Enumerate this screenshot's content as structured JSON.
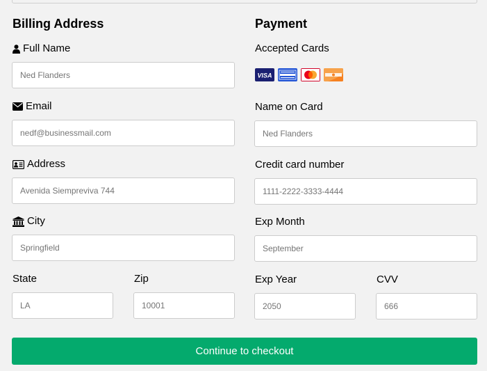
{
  "billing": {
    "heading": "Billing Address",
    "full_name_label": "Full Name",
    "full_name_placeholder": "Ned Flanders",
    "email_label": "Email",
    "email_placeholder": "nedf@businessmail.com",
    "address_label": "Address",
    "address_placeholder": "Avenida Siempreviva 744",
    "city_label": "City",
    "city_placeholder": "Springfield",
    "state_label": "State",
    "state_placeholder": "LA",
    "zip_label": "Zip",
    "zip_placeholder": "10001"
  },
  "payment": {
    "heading": "Payment",
    "accepted_cards_label": "Accepted Cards",
    "cards": [
      "visa-card-icon",
      "amex-card-icon",
      "mastercard-card-icon",
      "discover-card-icon"
    ],
    "name_on_card_label": "Name on Card",
    "name_on_card_placeholder": "Ned Flanders",
    "card_number_label": "Credit card number",
    "card_number_placeholder": "1111-2222-3333-4444",
    "exp_month_label": "Exp Month",
    "exp_month_placeholder": "September",
    "exp_year_label": "Exp Year",
    "exp_year_placeholder": "2050",
    "cvv_label": "CVV",
    "cvv_placeholder": "666"
  },
  "checkout_button_label": "Continue to checkout",
  "colors": {
    "background": "#f2f2f2",
    "button": "#04aa6d",
    "input_border": "#cccccc",
    "visa": "#1a1f71",
    "amex": "#2557d6",
    "mastercard": "#d10429",
    "discover": "#f68121"
  }
}
